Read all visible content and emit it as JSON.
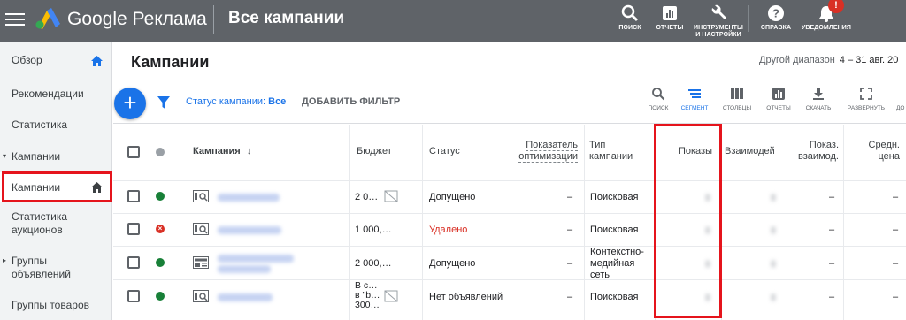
{
  "topbar": {
    "brand": "Google Реклама",
    "page_header": "Все кампании",
    "items": [
      {
        "label": "ПОИСК",
        "icon": "search-icon"
      },
      {
        "label": "ОТЧЕТЫ",
        "icon": "reports-icon"
      },
      {
        "label": "ИНСТРУМЕНТЫ И НАСТРОЙКИ",
        "icon": "wrench-icon"
      },
      {
        "label": "СПРАВКА",
        "icon": "help-icon"
      },
      {
        "label": "УВЕДОМЛЕНИЯ",
        "icon": "bell-icon",
        "badge": "!"
      }
    ]
  },
  "sidebar": {
    "items": [
      {
        "label": "Обзор",
        "icon": "home-icon"
      },
      {
        "label": "Рекомендации"
      },
      {
        "label": "Статистика"
      },
      {
        "label": "Кампании",
        "expandable": true
      },
      {
        "label": "Кампании",
        "active": true,
        "icon": "home-icon"
      },
      {
        "label": "Статистика аукционов"
      },
      {
        "label": "Группы объявлений",
        "expandable": true
      },
      {
        "label": "Группы товаров"
      }
    ]
  },
  "main": {
    "title": "Кампании",
    "date_range_label": "Другой диапазон",
    "date_range_value": "4 – 31 авг. 20"
  },
  "toolbar": {
    "add_button": "+",
    "filter_prefix": "Статус кампании:",
    "filter_value": "Все",
    "add_filter": "ДОБАВИТЬ ФИЛЬТР",
    "tools": [
      {
        "label": "ПОИСК",
        "icon": "search-icon"
      },
      {
        "label": "СЕГМЕНТ",
        "icon": "segment-icon",
        "active": true
      },
      {
        "label": "СТОЛБЦЫ",
        "icon": "columns-icon"
      },
      {
        "label": "ОТЧЕТЫ",
        "icon": "reports-icon"
      },
      {
        "label": "СКАЧАТЬ",
        "icon": "download-icon"
      },
      {
        "label": "РАЗВЕРНУТЬ",
        "icon": "expand-icon"
      },
      {
        "label": "ДО",
        "icon": "more-icon"
      }
    ]
  },
  "table": {
    "headers": {
      "campaign": "Кампания",
      "sort_arrow": "↓",
      "budget": "Бюджет",
      "status": "Статус",
      "optimization_score": "Показатель оптимизации",
      "campaign_type": "Тип кампании",
      "impressions": "Показы",
      "interactions": "Взаимодей",
      "interaction_rate": "Показ. взаимод.",
      "avg_cost": "Средн. цена"
    },
    "rows": [
      {
        "status_color": "green",
        "budget": "2 0…",
        "status": "Допущено",
        "opt": "–",
        "type": "Поисковая",
        "rate": "–",
        "cost": "–"
      },
      {
        "status_color": "red",
        "budget": "1 000,…",
        "status": "Удалено",
        "opt": "–",
        "type": "Поисковая",
        "rate": "–",
        "cost": "–"
      },
      {
        "status_color": "green",
        "budget": "2 000,…",
        "status": "Допущено",
        "opt": "–",
        "type": "Контекстно-медийная сеть",
        "rate": "–",
        "cost": "–"
      },
      {
        "status_color": "green",
        "budget": "В с… в \"b… 300…",
        "status": "Нет объявлений",
        "opt": "–",
        "type": "Поисковая",
        "rate": "–",
        "cost": "–"
      }
    ]
  }
}
